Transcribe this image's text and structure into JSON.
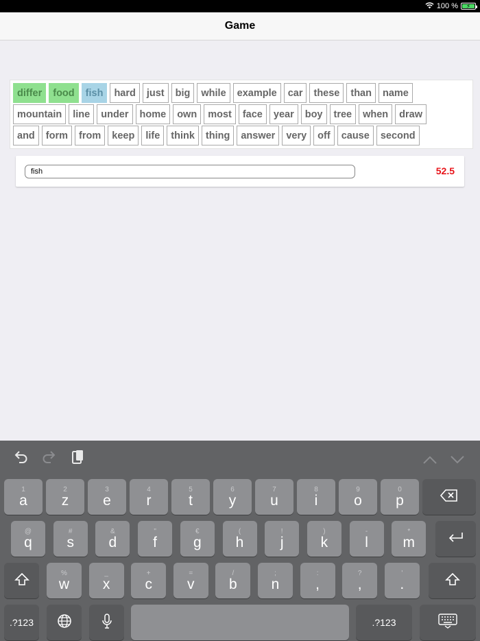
{
  "status": {
    "battery_text": "100 %",
    "battery_level": 1.0
  },
  "nav": {
    "title": "Game"
  },
  "words": {
    "rows": [
      [
        {
          "text": "differ",
          "state": "done"
        },
        {
          "text": "food",
          "state": "done"
        },
        {
          "text": "fish",
          "state": "current"
        },
        {
          "text": "hard",
          "state": "pending"
        },
        {
          "text": "just",
          "state": "pending"
        },
        {
          "text": "big",
          "state": "pending"
        },
        {
          "text": "while",
          "state": "pending"
        },
        {
          "text": "example",
          "state": "pending"
        },
        {
          "text": "car",
          "state": "pending"
        },
        {
          "text": "these",
          "state": "pending"
        },
        {
          "text": "than",
          "state": "pending"
        },
        {
          "text": "name",
          "state": "pending"
        }
      ],
      [
        {
          "text": "mountain",
          "state": "pending"
        },
        {
          "text": "line",
          "state": "pending"
        },
        {
          "text": "under",
          "state": "pending"
        },
        {
          "text": "home",
          "state": "pending"
        },
        {
          "text": "own",
          "state": "pending"
        },
        {
          "text": "most",
          "state": "pending"
        },
        {
          "text": "face",
          "state": "pending"
        },
        {
          "text": "year",
          "state": "pending"
        },
        {
          "text": "boy",
          "state": "pending"
        },
        {
          "text": "tree",
          "state": "pending"
        },
        {
          "text": "when",
          "state": "pending"
        },
        {
          "text": "draw",
          "state": "pending"
        }
      ],
      [
        {
          "text": "and",
          "state": "pending"
        },
        {
          "text": "form",
          "state": "pending"
        },
        {
          "text": "from",
          "state": "pending"
        },
        {
          "text": "keep",
          "state": "pending"
        },
        {
          "text": "life",
          "state": "pending"
        },
        {
          "text": "think",
          "state": "pending"
        },
        {
          "text": "thing",
          "state": "pending"
        },
        {
          "text": "answer",
          "state": "pending"
        },
        {
          "text": "very",
          "state": "pending"
        },
        {
          "text": "off",
          "state": "pending"
        },
        {
          "text": "cause",
          "state": "pending"
        },
        {
          "text": "second",
          "state": "pending"
        }
      ]
    ]
  },
  "input": {
    "value": "fish",
    "timer": "52.5"
  },
  "colors": {
    "done": "#8fe08f",
    "current": "#a8d4e6",
    "timer": "#e8141a"
  },
  "keyboard": {
    "toolbar": {
      "undo": "undo-icon",
      "redo": "redo-icon",
      "paste": "paste-icon",
      "up": "chevron-up-icon",
      "down": "chevron-down-icon"
    },
    "row1": [
      {
        "hint": "1",
        "main": "a"
      },
      {
        "hint": "2",
        "main": "z"
      },
      {
        "hint": "3",
        "main": "e"
      },
      {
        "hint": "4",
        "main": "r"
      },
      {
        "hint": "5",
        "main": "t"
      },
      {
        "hint": "6",
        "main": "y"
      },
      {
        "hint": "7",
        "main": "u"
      },
      {
        "hint": "8",
        "main": "i"
      },
      {
        "hint": "9",
        "main": "o"
      },
      {
        "hint": "0",
        "main": "p"
      }
    ],
    "row2": [
      {
        "hint": "@",
        "main": "q"
      },
      {
        "hint": "#",
        "main": "s"
      },
      {
        "hint": "&",
        "main": "d"
      },
      {
        "hint": "\"",
        "main": "f"
      },
      {
        "hint": "€",
        "main": "g"
      },
      {
        "hint": "(",
        "main": "h"
      },
      {
        "hint": "!",
        "main": "j"
      },
      {
        "hint": ")",
        "main": "k"
      },
      {
        "hint": "-",
        "main": "l"
      },
      {
        "hint": "*",
        "main": "m"
      }
    ],
    "row3": [
      {
        "hint": "%",
        "main": "w"
      },
      {
        "hint": "_",
        "main": "x"
      },
      {
        "hint": "+",
        "main": "c"
      },
      {
        "hint": "=",
        "main": "v"
      },
      {
        "hint": "/",
        "main": "b"
      },
      {
        "hint": ";",
        "main": "n"
      },
      {
        "hint": ":",
        "main": ","
      },
      {
        "hint": "?",
        "main": ","
      },
      {
        "hint": "'",
        "main": "."
      }
    ],
    "mode_label": ".?123"
  }
}
